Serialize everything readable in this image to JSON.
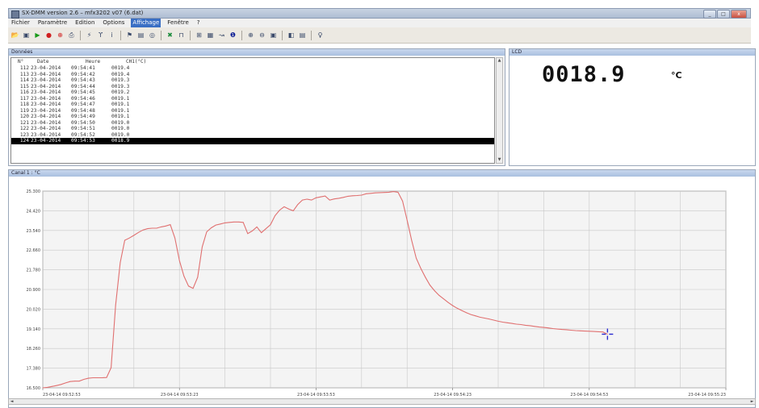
{
  "window": {
    "title": "SX-DMM version 2.6 – mfx3202 v07 (6.dat)",
    "buttons": [
      "_",
      "□",
      "x"
    ]
  },
  "menu": [
    {
      "label": "Fichier",
      "active": false
    },
    {
      "label": "Paramètre",
      "active": false
    },
    {
      "label": "Edition",
      "active": false
    },
    {
      "label": "Options",
      "active": false
    },
    {
      "label": "Affichage",
      "active": true
    },
    {
      "label": "Fenêtre",
      "active": false
    },
    {
      "label": "?",
      "active": false
    }
  ],
  "toolbar": {
    "icons": [
      "open-icon",
      "save-icon",
      "play-icon",
      "stop-icon",
      "record-icon",
      "print-icon",
      "sep",
      "connect-icon",
      "probe-icon",
      "info-icon",
      "sep",
      "trigger-icon",
      "table-icon",
      "camera-icon",
      "sep",
      "delete-icon",
      "filter-icon",
      "sep",
      "grid-icon",
      "chart-icon",
      "curve-icon",
      "help-circle-icon",
      "sep",
      "zoom-in-icon",
      "zoom-out-icon",
      "zoom-fit-icon",
      "sep",
      "window-icon",
      "layout-icon",
      "sep",
      "hint-icon"
    ],
    "icon_colors": {
      "play-icon": "#1a9a1a",
      "stop-icon": "#d02020",
      "record-icon": "#d02020",
      "delete-icon": "#1c8c3c",
      "help-circle-icon": "#1a2a9a"
    }
  },
  "data_panel": {
    "title": "Données",
    "headers": [
      "N°",
      "Date",
      "Heure",
      "CH1(°C)"
    ],
    "rows": [
      [
        "112",
        "23-04-2014",
        "09:54:41",
        "0019.4"
      ],
      [
        "113",
        "23-04-2014",
        "09:54:42",
        "0019.4"
      ],
      [
        "114",
        "23-04-2014",
        "09:54:43",
        "0019.3"
      ],
      [
        "115",
        "23-04-2014",
        "09:54:44",
        "0019.3"
      ],
      [
        "116",
        "23-04-2014",
        "09:54:45",
        "0019.2"
      ],
      [
        "117",
        "23-04-2014",
        "09:54:46",
        "0019.1"
      ],
      [
        "118",
        "23-04-2014",
        "09:54:47",
        "0019.1"
      ],
      [
        "119",
        "23-04-2014",
        "09:54:48",
        "0019.1"
      ],
      [
        "120",
        "23-04-2014",
        "09:54:49",
        "0019.1"
      ],
      [
        "121",
        "23-04-2014",
        "09:54:50",
        "0019.0"
      ],
      [
        "122",
        "23-04-2014",
        "09:54:51",
        "0019.0"
      ],
      [
        "123",
        "23-04-2014",
        "09:54:52",
        "0019.0"
      ],
      [
        "124",
        "23-04-2014",
        "09:54:53",
        "0018.9"
      ]
    ],
    "selected_row": 12
  },
  "lcd_panel": {
    "title": "LCD",
    "value": "0018.9",
    "unit": "°C"
  },
  "chart_panel": {
    "title": "Canal 1 : °C"
  },
  "chart_data": {
    "type": "line",
    "title": "Canal 1 : °C",
    "xlabel": "",
    "ylabel": "",
    "y_ticks": [
      "16.500",
      "17.380",
      "18.260",
      "19.140",
      "20.020",
      "20.900",
      "21.780",
      "22.660",
      "23.540",
      "24.420",
      "25.300"
    ],
    "ylim": [
      16.5,
      25.3
    ],
    "x_ticks": [
      "23-04-14 09:52:53",
      "23-04-14 09:53:23",
      "23-04-14 09:53:53",
      "23-04-14 09:54:23",
      "23-04-14 09:54:53",
      "23-04-14 09:55:23"
    ],
    "grid": true,
    "line_color": "#e07070",
    "cursor_color": "#2a2ad0",
    "series": [
      {
        "x": [
          0,
          1,
          2,
          3,
          4,
          5,
          6,
          7,
          8,
          9,
          10,
          11,
          12,
          13,
          14,
          15,
          16,
          17,
          18,
          19,
          20,
          21,
          22,
          23,
          24,
          25,
          26,
          27,
          28,
          29,
          30,
          31,
          32,
          33,
          34,
          35,
          36,
          37,
          38,
          39,
          40,
          41,
          42,
          43,
          44,
          45,
          46,
          47,
          48,
          49,
          50,
          51,
          52,
          53,
          54,
          55,
          56,
          57,
          58,
          59,
          60,
          61,
          62,
          63,
          64,
          65,
          66,
          67,
          68,
          69,
          70,
          71,
          72,
          73,
          74,
          75,
          76,
          77,
          78,
          79,
          80,
          81,
          82,
          83,
          84,
          85,
          86,
          87,
          88,
          89,
          90,
          91,
          92,
          93,
          94,
          95,
          96,
          97,
          98,
          99,
          100,
          101,
          102,
          103,
          104,
          105,
          106,
          107,
          108,
          109,
          110,
          111,
          112,
          113,
          114,
          115,
          116,
          117,
          118,
          119,
          120,
          121,
          122,
          123,
          124
        ],
        "y": [
          16.5,
          16.52,
          16.56,
          16.6,
          16.65,
          16.72,
          16.78,
          16.8,
          16.8,
          16.88,
          16.93,
          16.95,
          16.95,
          16.95,
          16.96,
          17.4,
          20.2,
          22.1,
          23.1,
          23.2,
          23.32,
          23.45,
          23.56,
          23.62,
          23.64,
          23.64,
          23.7,
          23.74,
          23.8,
          23.2,
          22.2,
          21.5,
          21.05,
          20.95,
          21.45,
          22.8,
          23.48,
          23.66,
          23.78,
          23.83,
          23.88,
          23.9,
          23.92,
          23.92,
          23.9,
          23.4,
          23.52,
          23.7,
          23.44,
          23.62,
          23.8,
          24.2,
          24.45,
          24.6,
          24.5,
          24.42,
          24.7,
          24.9,
          24.94,
          24.9,
          25.0,
          25.04,
          25.08,
          24.9,
          24.95,
          24.98,
          25.02,
          25.07,
          25.09,
          25.1,
          25.12,
          25.18,
          25.2,
          25.22,
          25.23,
          25.24,
          25.25,
          25.28,
          25.25,
          24.85,
          24.0,
          23.1,
          22.3,
          21.85,
          21.45,
          21.1,
          20.85,
          20.64,
          20.48,
          20.32,
          20.18,
          20.06,
          19.96,
          19.86,
          19.78,
          19.72,
          19.66,
          19.62,
          19.58,
          19.53,
          19.48,
          19.44,
          19.41,
          19.38,
          19.35,
          19.33,
          19.3,
          19.28,
          19.25,
          19.22,
          19.2,
          19.18,
          19.15,
          19.13,
          19.11,
          19.1,
          19.08,
          19.06,
          19.05,
          19.04,
          19.03,
          19.02,
          19.01,
          19.0,
          18.9
        ]
      }
    ]
  }
}
